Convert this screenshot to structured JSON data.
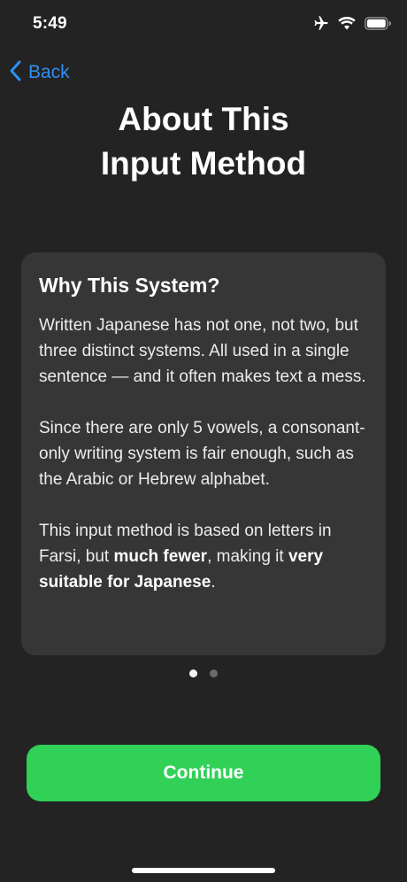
{
  "status_bar": {
    "time": "5:49",
    "icons": [
      "airplane-icon",
      "wifi-icon",
      "battery-icon"
    ]
  },
  "nav": {
    "back_label": "Back",
    "back_icon": "chevron-left-icon"
  },
  "page": {
    "title_line1": "About This",
    "title_line2": "Input Method"
  },
  "card": {
    "heading": "Why This System?",
    "paragraph1": "Written Japanese has not one, not two, but three distinct systems. All used in a single sentence — and it often makes text a mess.",
    "paragraph2": "Since there are only 5 vowels, a consonant-only writing system is fair enough, such as the Arabic or Hebrew alphabet.",
    "paragraph3": {
      "part1": "This input method is based on letters in Farsi, but ",
      "bold1": "much fewer",
      "part2": ", making it ",
      "bold2": "very suitable for Japanese",
      "part3": "."
    }
  },
  "pager": {
    "total": 2,
    "current": 1
  },
  "actions": {
    "continue_label": "Continue"
  },
  "colors": {
    "background": "#232323",
    "card": "#363636",
    "accent_blue": "#2f8ff3",
    "button_green": "#31d158"
  }
}
